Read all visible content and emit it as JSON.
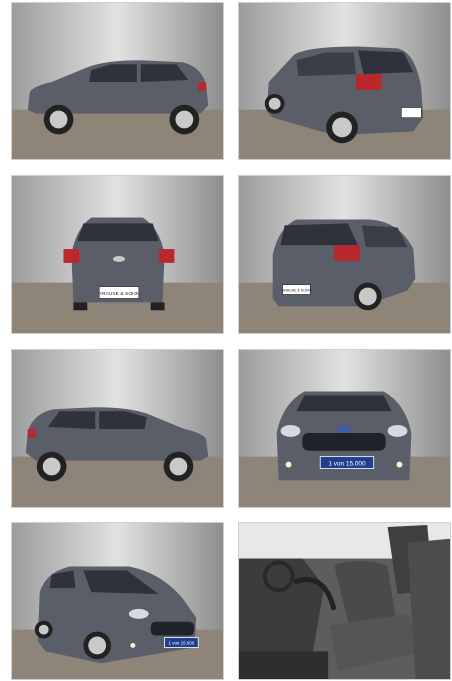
{
  "gallery": {
    "dealer_plate_text": "KRAUSE & SOHN",
    "front_plate_text": "1 von 15.000",
    "colors": {
      "car_body": "#5a5e69",
      "studio_wall": "#b9b9b9",
      "studio_floor": "#8f8478"
    }
  }
}
